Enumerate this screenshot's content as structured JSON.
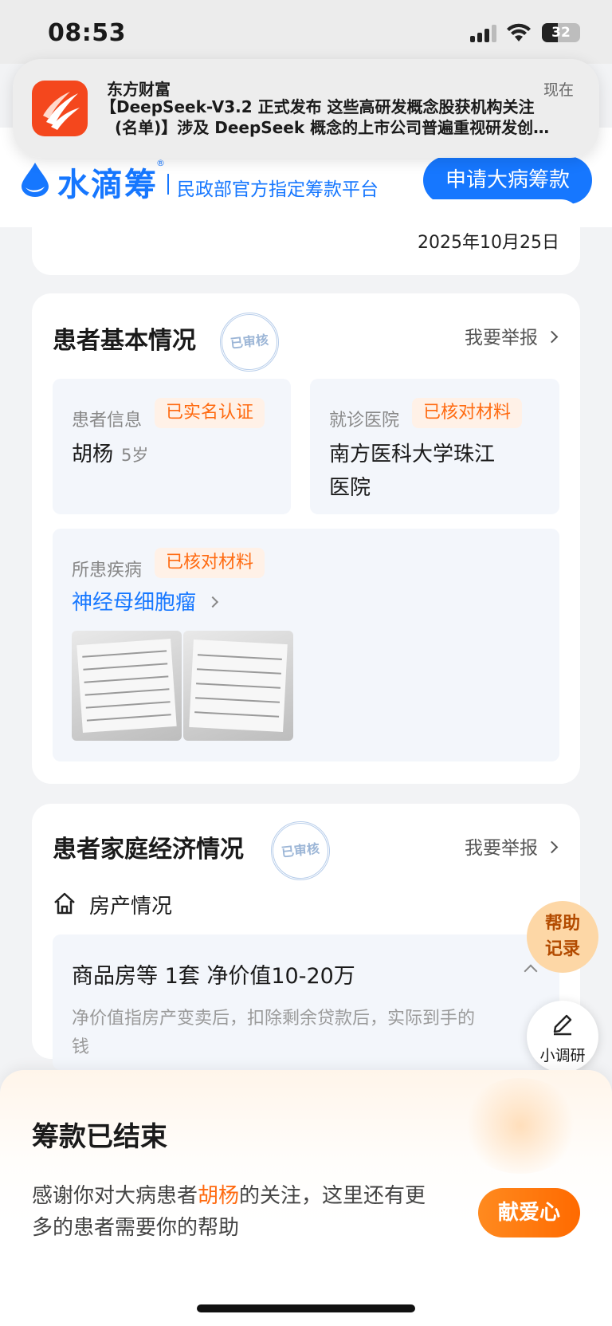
{
  "status_bar": {
    "time": "08:53",
    "battery": "32"
  },
  "notification": {
    "app_name": "东方财富",
    "time": "现在",
    "line1": "【DeepSeek-V3.2 正式发布 这些高研发概念股获机构关注",
    "line2": "(名单)】涉及 DeepSeek 概念的上市公司普遍重视研发创…"
  },
  "header": {
    "brand": "水滴筹",
    "registered": "®",
    "slogan": "民政部官方指定筹款平台",
    "apply_button": "申请大病筹款"
  },
  "date_card": {
    "date": "2025年10月25日"
  },
  "basic_info": {
    "title": "患者基本情况",
    "stamp": "已审核",
    "report": "我要举报",
    "patient": {
      "label": "患者信息",
      "tag": "已实名认证",
      "name": "胡杨",
      "age": "5岁"
    },
    "hospital": {
      "label": "就诊医院",
      "tag": "已核对材料",
      "name_line1": "南方医科大学珠江",
      "name_line2": "医院"
    },
    "disease": {
      "label": "所患疾病",
      "tag": "已核对材料",
      "name": "神经母细胞瘤"
    }
  },
  "economy": {
    "title": "患者家庭经济情况",
    "stamp": "已审核",
    "report": "我要举报",
    "property_label": "房产情况",
    "property_main": "商品房等 1套 净价值10-20万",
    "property_note": "净价值指房产变卖后，扣除剩余贷款后，实际到手的钱"
  },
  "floating": {
    "help_line1": "帮助",
    "help_line2": "记录",
    "survey": "小调研"
  },
  "sheet": {
    "title": "筹款已结束",
    "msg_prefix": "感谢你对大病患者",
    "msg_name": "胡杨",
    "msg_suffix": "的关注，这里还有更多的患者需要你的帮助",
    "donate_button": "献爱心"
  },
  "colors": {
    "brand_blue": "#1677ff",
    "tag_orange": "#ff6a10",
    "notif_icon": "#f4471d"
  },
  "icons": [
    "signal-icon",
    "wifi-icon",
    "battery-icon",
    "water-drop-icon",
    "chevron-right-icon",
    "house-icon",
    "chevron-up-icon",
    "pen-icon"
  ]
}
